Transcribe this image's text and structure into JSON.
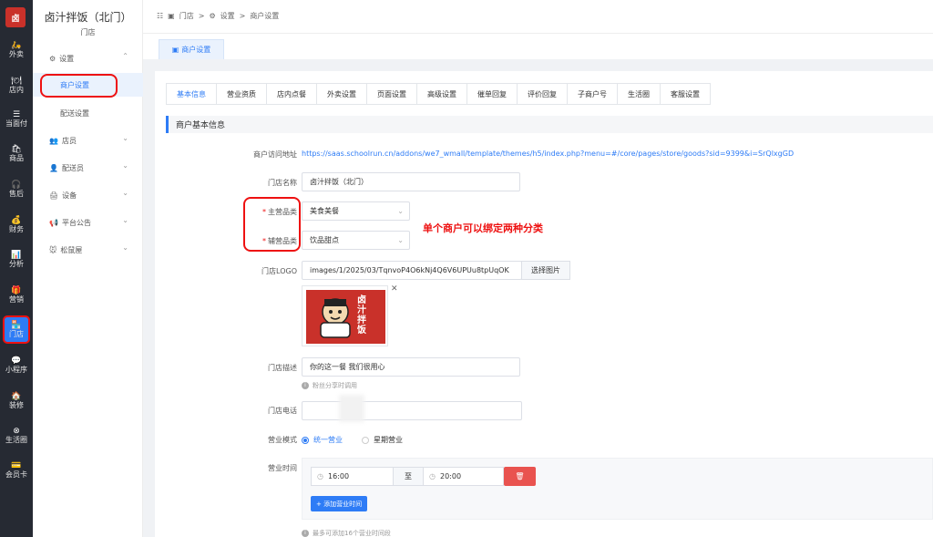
{
  "rail": {
    "logo_text": "卤",
    "items": [
      {
        "icon": "🛵",
        "label": "外卖"
      },
      {
        "icon": "🍽",
        "label": "店内"
      },
      {
        "icon": "☰",
        "label": "当面付"
      },
      {
        "icon": "🛍",
        "label": "商品"
      },
      {
        "icon": "🎧",
        "label": "售后"
      },
      {
        "icon": "💰",
        "label": "财务"
      },
      {
        "icon": "📊",
        "label": "分析"
      },
      {
        "icon": "🎁",
        "label": "营销"
      },
      {
        "icon": "🏪",
        "label": "门店"
      },
      {
        "icon": "💬",
        "label": "小程序"
      },
      {
        "icon": "🏠",
        "label": "装修"
      },
      {
        "icon": "⊗",
        "label": "生活圈"
      },
      {
        "icon": "💳",
        "label": "会员卡"
      }
    ],
    "active_label": "门店"
  },
  "sidebar": {
    "store_name": "卤汁拌饭（北门）",
    "store_sub": "门店",
    "menu": [
      {
        "icon": "⚙",
        "label": "设置",
        "chevron": "⌃"
      },
      {
        "label": "商户设置",
        "sub": true,
        "active": true
      },
      {
        "label": "配送设置",
        "sub": true
      },
      {
        "icon": "👥",
        "label": "店员",
        "chevron": "⌄"
      },
      {
        "icon": "👤",
        "label": "配送员",
        "chevron": "⌄"
      },
      {
        "icon": "🖨",
        "label": "设备",
        "chevron": "⌄"
      },
      {
        "icon": "📢",
        "label": "平台公告",
        "chevron": "⌄"
      },
      {
        "icon": "🐭",
        "label": "松鼠屋",
        "chevron": "⌄"
      }
    ]
  },
  "breadcrumb": [
    "门店",
    "设置",
    "商户设置"
  ],
  "page_tab": "商户设置",
  "tabs": [
    "基本信息",
    "营业资质",
    "店内点餐",
    "外卖设置",
    "页面设置",
    "高级设置",
    "催单回复",
    "评价回复",
    "子商户号",
    "生活圈",
    "客服设置"
  ],
  "active_tab": "基本信息",
  "section_title": "商户基本信息",
  "form": {
    "visit_url_label": "商户访问地址",
    "visit_url": "https://saas.schoolrun.cn/addons/we7_wmall/template/themes/h5/index.php?menu=#/core/pages/store/goods?sid=9399&i=SrQlxgGD",
    "name_label": "门店名称",
    "name_value": "卤汁拌饭（北门）",
    "main_cat_label": "主营品类",
    "main_cat_value": "美食美餐",
    "sub_cat_label": "辅营品类",
    "sub_cat_value": "饮品甜点",
    "note": "单个商户可以绑定两种分类",
    "logo_label": "门店LOGO",
    "logo_path": "images/1/2025/03/TqnvoP4O6kNj4Q6V6UPUu8tpUqOK",
    "logo_btn": "选择图片",
    "logo_brand_text": "卤汁拌饭",
    "desc_label": "门店描述",
    "desc_value": "你的这一餐  我们很用心",
    "desc_hint": "粉丝分享时调用",
    "phone_label": "门店电话",
    "mode_label": "营业模式",
    "mode_options": [
      "统一营业",
      "星期营业"
    ],
    "hours_label": "营业时间",
    "start_time": "16:00",
    "to_label": "至",
    "end_time": "20:00",
    "add_hours_btn": "+ 添加营业时间",
    "hours_hint": "最多可添加16个营业时间段"
  },
  "colors": {
    "primary": "#2e7cf6",
    "danger": "#e9534f",
    "rail": "#262a33",
    "highlight": "#ee1111"
  }
}
